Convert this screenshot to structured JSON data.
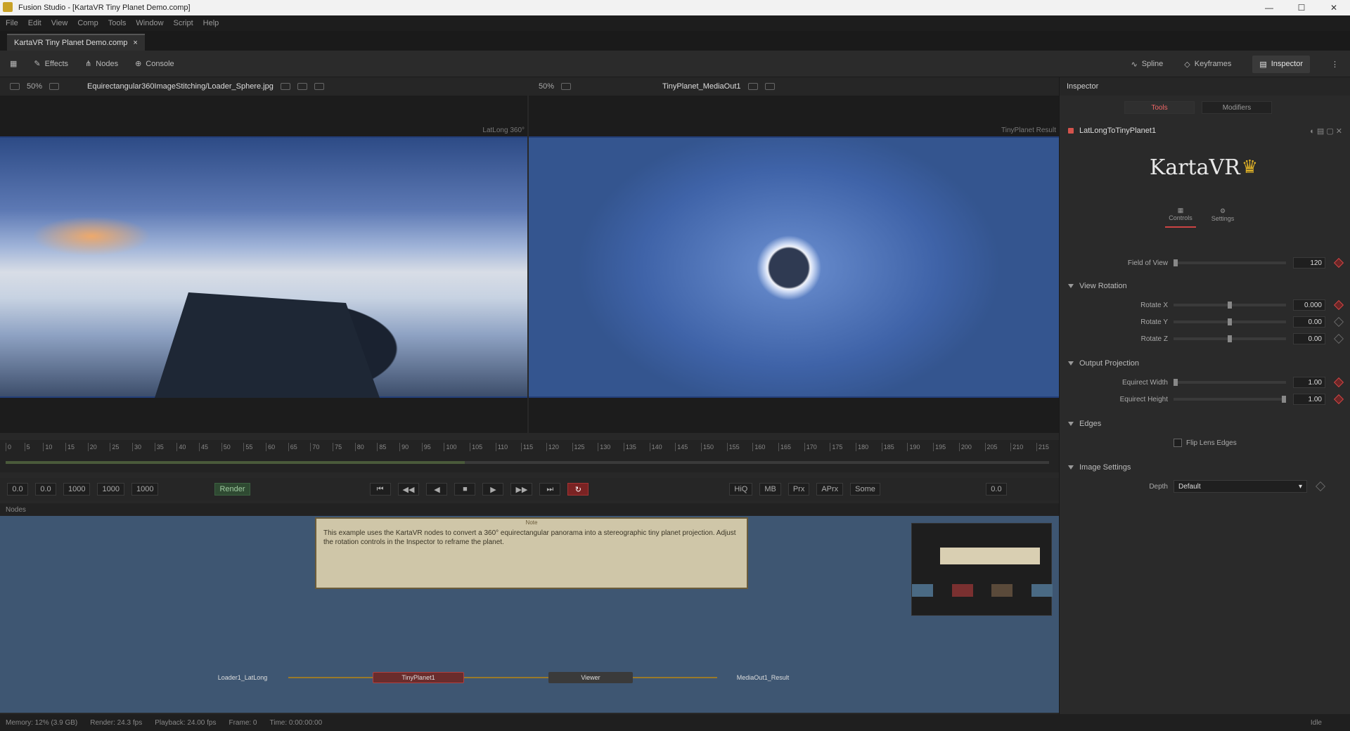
{
  "window": {
    "title": "Fusion Studio - [KartaVR Tiny Planet Demo.comp]",
    "minimize": "—",
    "maximize": "☐",
    "close": "✕"
  },
  "menu": [
    "File",
    "Edit",
    "View",
    "Comp",
    "Tools",
    "Window",
    "Script",
    "Help"
  ],
  "doc_tab": {
    "label": "KartaVR Tiny Planet Demo.comp",
    "close": "×"
  },
  "toolbar": {
    "left": [
      {
        "icon": "grid-icon",
        "label": ""
      },
      {
        "icon": "effects-icon",
        "label": "Effects"
      },
      {
        "icon": "nodes-icon",
        "label": "Nodes"
      },
      {
        "icon": "console-icon",
        "label": "Console"
      }
    ],
    "right": [
      {
        "icon": "spline-icon",
        "label": "Spline"
      },
      {
        "icon": "keyframes-icon",
        "label": "Keyframes"
      },
      {
        "icon": "inspector-icon",
        "label": "Inspector"
      }
    ]
  },
  "viewer_left": {
    "path": "Equirectangular360ImageStitching/Loader_Sphere.jpg",
    "zoom": "50%",
    "label": "LatLong 360°"
  },
  "viewer_right": {
    "path": "TinyPlanet_MediaOut1",
    "zoom": "50%",
    "label": "TinyPlanet Result"
  },
  "timeline": {
    "ticks": [
      "0",
      "5",
      "10",
      "15",
      "20",
      "25",
      "30",
      "35",
      "40",
      "45",
      "50",
      "55",
      "60",
      "65",
      "70",
      "75",
      "80",
      "85",
      "90",
      "95",
      "100",
      "105",
      "110",
      "115",
      "120",
      "125",
      "130",
      "135",
      "140",
      "145",
      "150",
      "155",
      "160",
      "165",
      "170",
      "175",
      "180",
      "185",
      "190",
      "195",
      "200",
      "205",
      "210",
      "215"
    ],
    "progress": 0.44
  },
  "transport": {
    "start": "0.0",
    "in": "0.0",
    "current": "1000",
    "out": "1000",
    "end": "1000",
    "render_label": "Render",
    "hiq": "HiQ",
    "mb": "MB",
    "prx": "Prx",
    "aprx": "APrx",
    "some": "Some",
    "frame": "0.0"
  },
  "node_editor": {
    "header": "Nodes",
    "sticky_title": "Note",
    "sticky_text": "This example uses the KartaVR nodes to convert a 360° equirectangular panorama into a stereographic tiny planet projection. Adjust the rotation controls in the Inspector to reframe the planet.",
    "nodes": [
      {
        "name": "Loader1_LatLong",
        "color": "#3e5672"
      },
      {
        "name": "TinyPlanet1",
        "color": "#6a2c2c"
      },
      {
        "name": "Viewer",
        "color": "#3a3a3a"
      },
      {
        "name": "MediaOut1_Result",
        "color": "#3e5672"
      }
    ]
  },
  "statusbar": {
    "left": [
      "Memory: 12% (3.9 GB)",
      "Render: 24.3 fps",
      "Playback: 24.00 fps",
      "Frame: 0",
      "Time: 0:00:00:00"
    ],
    "right": "Idle"
  },
  "inspector": {
    "tabs": [
      "Tools",
      "Modifiers"
    ],
    "tool_name": "LatLongToTinyPlanet1",
    "logo_text": "KartaVR",
    "subtabs": [
      "Controls",
      "Settings"
    ],
    "fov": {
      "label": "Field of View",
      "value": "120"
    },
    "sections": {
      "rotation": "View Rotation",
      "output": "Output Projection",
      "edges": "Edges",
      "image": "Image Settings"
    },
    "rotation": [
      {
        "label": "Rotate X",
        "value": "0.000"
      },
      {
        "label": "Rotate Y",
        "value": "0.00"
      },
      {
        "label": "Rotate Z",
        "value": "0.00"
      }
    ],
    "output": [
      {
        "label": "Equirect Width",
        "value": "1.00"
      },
      {
        "label": "Equirect Height",
        "value": "1.00"
      }
    ],
    "edges_option": "Flip Lens Edges",
    "depth_label": "Depth",
    "depth_value": "Default"
  }
}
